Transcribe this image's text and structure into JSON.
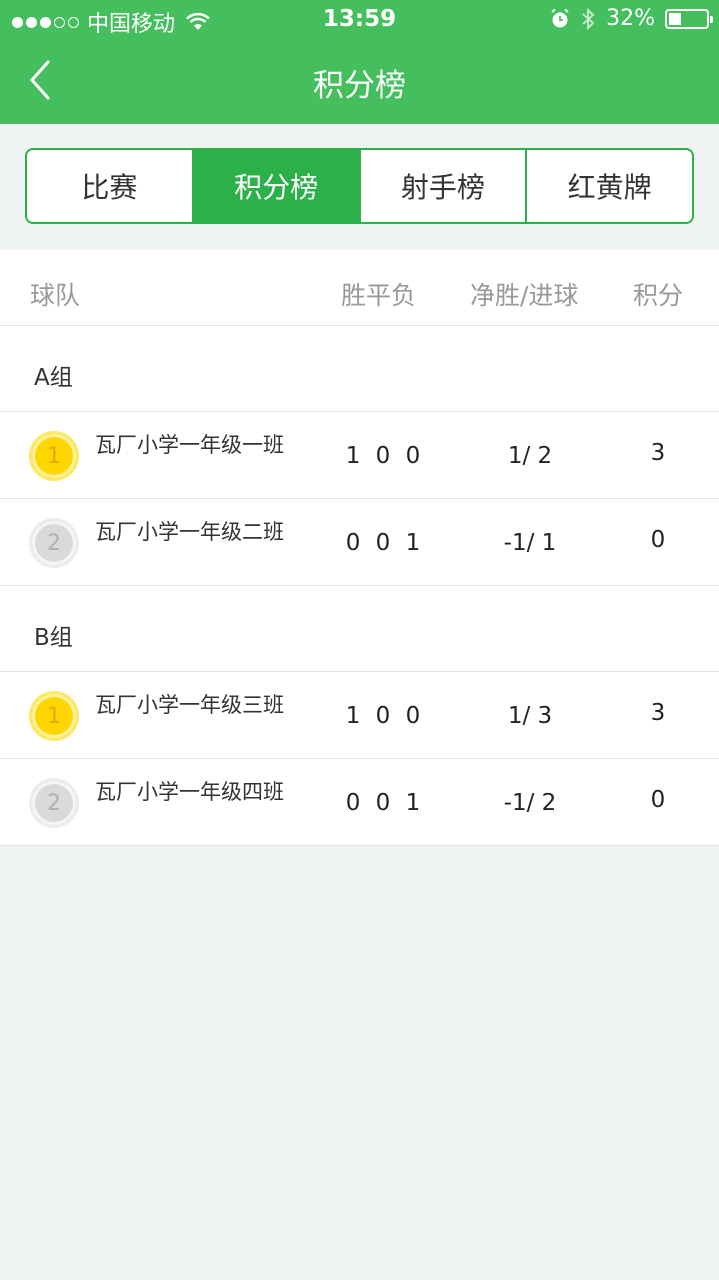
{
  "status_bar": {
    "carrier": "中国移动",
    "time": "13:59",
    "battery_percent": "32%",
    "battery_level": 0.32
  },
  "nav": {
    "title": "积分榜"
  },
  "tabs": [
    {
      "label": "比赛",
      "active": false
    },
    {
      "label": "积分榜",
      "active": true
    },
    {
      "label": "射手榜",
      "active": false
    },
    {
      "label": "红黄牌",
      "active": false
    }
  ],
  "table": {
    "headers": {
      "team": "球队",
      "record": "胜平负",
      "goals": "净胜/进球",
      "points": "积分"
    },
    "groups": [
      {
        "name": "A组",
        "rows": [
          {
            "rank": "1",
            "medal": "gold",
            "team": "瓦厂小学一年级一班",
            "record": "1 0 0",
            "goals": "1/ 2",
            "points": "3"
          },
          {
            "rank": "2",
            "medal": "silver",
            "team": "瓦厂小学一年级二班",
            "record": "0 0 1",
            "goals": "-1/ 1",
            "points": "0"
          }
        ]
      },
      {
        "name": "B组",
        "rows": [
          {
            "rank": "1",
            "medal": "gold",
            "team": "瓦厂小学一年级三班",
            "record": "1 0 0",
            "goals": "1/ 3",
            "points": "3"
          },
          {
            "rank": "2",
            "medal": "silver",
            "team": "瓦厂小学一年级四班",
            "record": "0 0 1",
            "goals": "-1/ 2",
            "points": "0"
          }
        ]
      }
    ]
  },
  "colors": {
    "brand_green": "#45bf5d",
    "tab_green": "#2cb04a",
    "gold": "#ffd600",
    "silver": "#dadada"
  }
}
